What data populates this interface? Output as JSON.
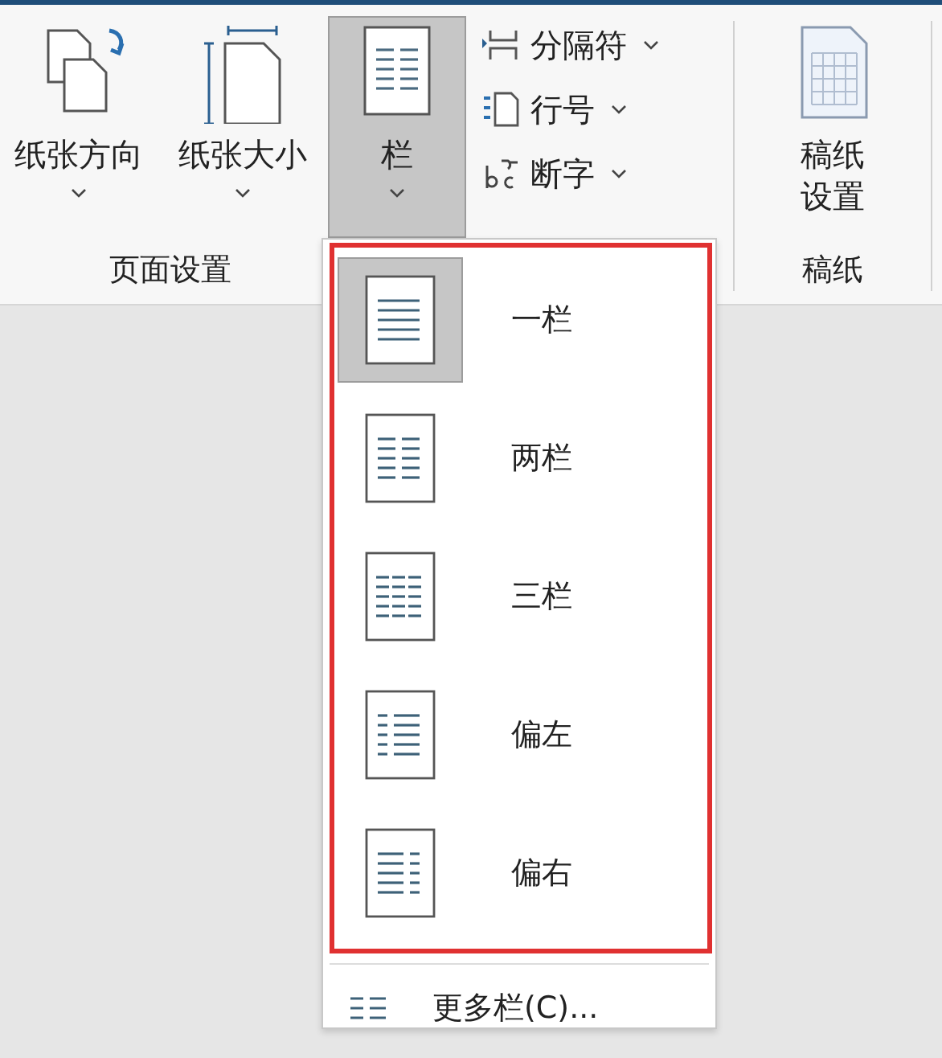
{
  "ribbon": {
    "groups": [
      {
        "label": "页面设置",
        "large_buttons": [
          {
            "label": "纸张方向",
            "kind": "orientation",
            "selected": false,
            "has_menu": true
          },
          {
            "label": "纸张大小",
            "kind": "size",
            "selected": false,
            "has_menu": true
          },
          {
            "label": "栏",
            "kind": "columns",
            "selected": true,
            "has_menu": true
          }
        ],
        "small_buttons": [
          {
            "label": "分隔符",
            "kind": "breaks",
            "has_menu": true
          },
          {
            "label": "行号",
            "kind": "line-numbers",
            "has_menu": true
          },
          {
            "label": "断字",
            "kind": "hyphenation",
            "has_menu": true
          }
        ]
      },
      {
        "label": "稿纸",
        "large_buttons": [
          {
            "label": "稿纸设置",
            "kind": "grid-paper",
            "selected": false,
            "has_menu": false
          }
        ]
      }
    ]
  },
  "columns_menu": {
    "items": [
      {
        "label": "一栏",
        "kind": "one",
        "selected": true
      },
      {
        "label": "两栏",
        "kind": "two",
        "selected": false
      },
      {
        "label": "三栏",
        "kind": "three",
        "selected": false
      },
      {
        "label": "偏左",
        "kind": "left",
        "selected": false
      },
      {
        "label": "偏右",
        "kind": "right",
        "selected": false
      }
    ],
    "more": {
      "label": "更多栏(C)..."
    }
  }
}
